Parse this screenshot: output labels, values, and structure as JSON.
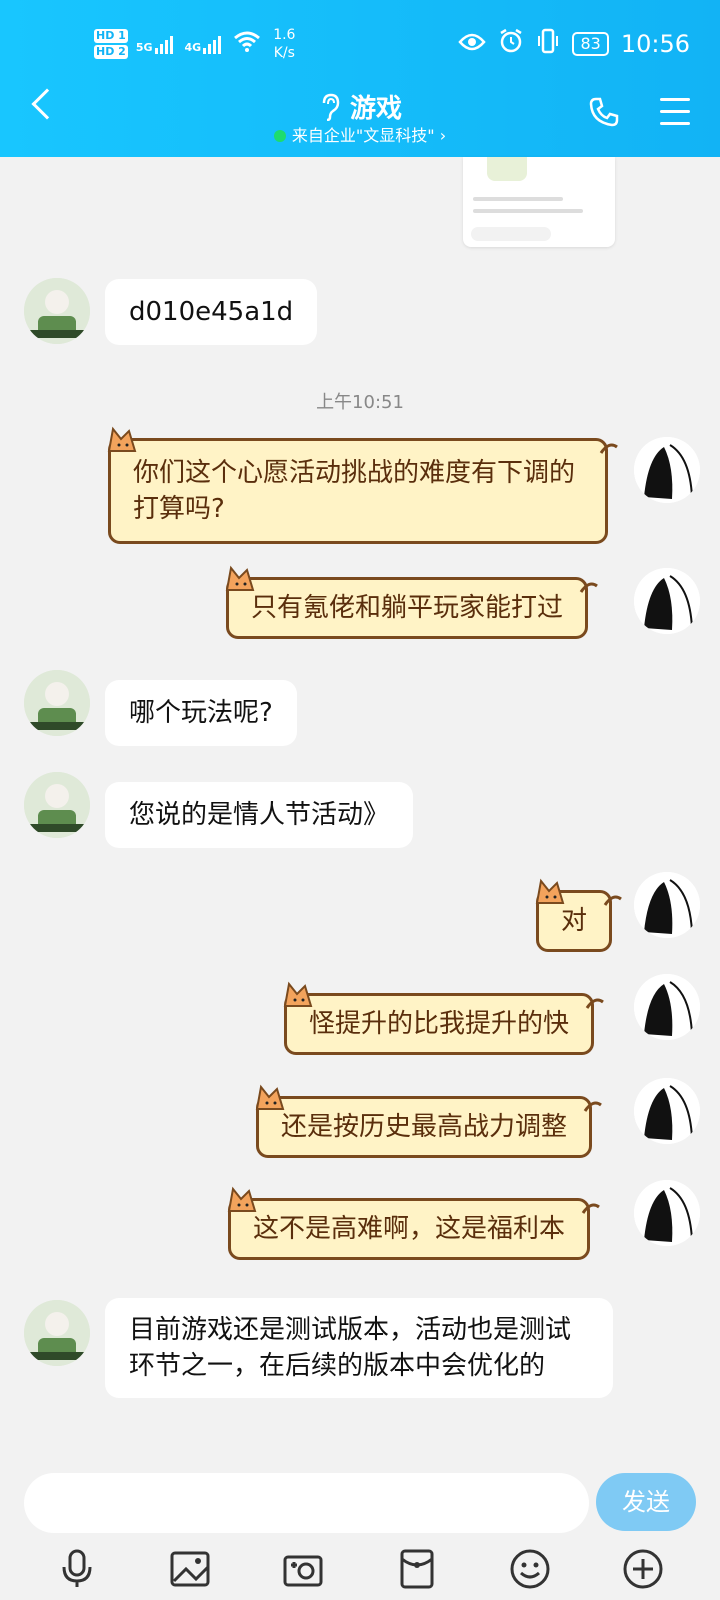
{
  "status_bar": {
    "hd1": "HD 1",
    "hd2": "HD 2",
    "net1": "5G",
    "net2": "4G",
    "speed_value": "1.6",
    "speed_unit": "K/s",
    "battery": "83",
    "time": "10:56"
  },
  "header": {
    "title": "游戏",
    "subtitle": "来自企业\"文显科技\" ›"
  },
  "messages": [
    {
      "side": "left",
      "text": "d010e45a1d"
    },
    {
      "side": "right",
      "text": "你们这个心愿活动挑战的难度有下调的打算吗?"
    },
    {
      "side": "right",
      "text": "只有氪佬和躺平玩家能打过"
    },
    {
      "side": "left",
      "text": "哪个玩法呢?"
    },
    {
      "side": "left",
      "text": "您说的是情人节活动》"
    },
    {
      "side": "right",
      "text": "对"
    },
    {
      "side": "right",
      "text": "怪提升的比我提升的快"
    },
    {
      "side": "right",
      "text": "还是按历史最高战力调整"
    },
    {
      "side": "right",
      "text": "这不是高难啊，这是福利本"
    },
    {
      "side": "left",
      "text": "目前游戏还是测试版本，活动也是测试环节之一，在后续的版本中会优化的"
    }
  ],
  "timestamp": "上午10:51",
  "input": {
    "send_label": "发送"
  },
  "toolbar_icons": [
    "microphone-icon",
    "image-icon",
    "camera-icon",
    "red-packet-icon",
    "emoji-icon",
    "plus-icon"
  ],
  "colors": {
    "header": "#12b3f5",
    "bubble_right": "#fff3c6",
    "bubble_border": "#7a4a1e",
    "send_button": "#7fcaf4"
  }
}
